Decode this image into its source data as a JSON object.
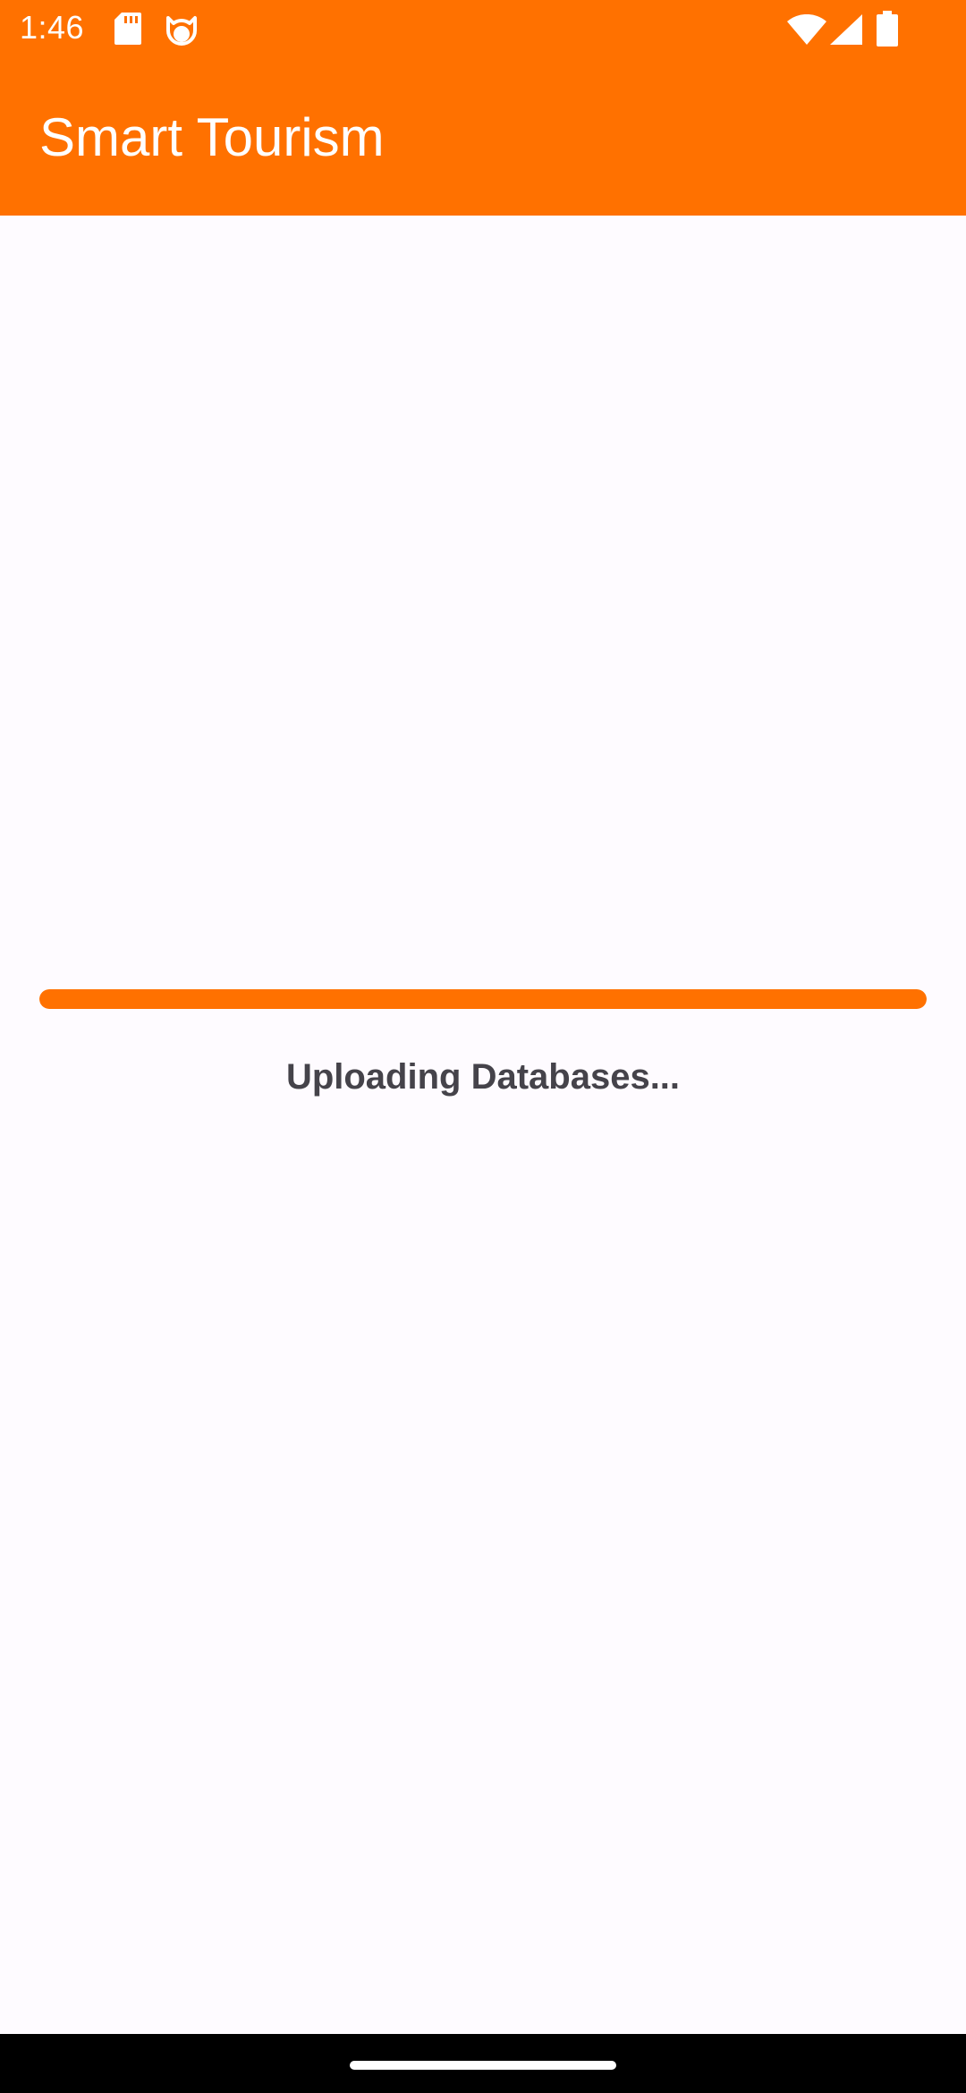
{
  "status_bar": {
    "time": "1:46",
    "icons": [
      "sd-card-icon",
      "cat-face-icon",
      "wifi-icon",
      "cellular-signal-icon",
      "battery-icon"
    ]
  },
  "app_bar": {
    "title": "Smart Tourism",
    "color": "#ff7100"
  },
  "upload": {
    "progress_percent": 100,
    "message": "Uploading Databases..."
  },
  "colors": {
    "accent": "#ff7100",
    "background": "#fefbff",
    "message_text": "#45434a"
  }
}
